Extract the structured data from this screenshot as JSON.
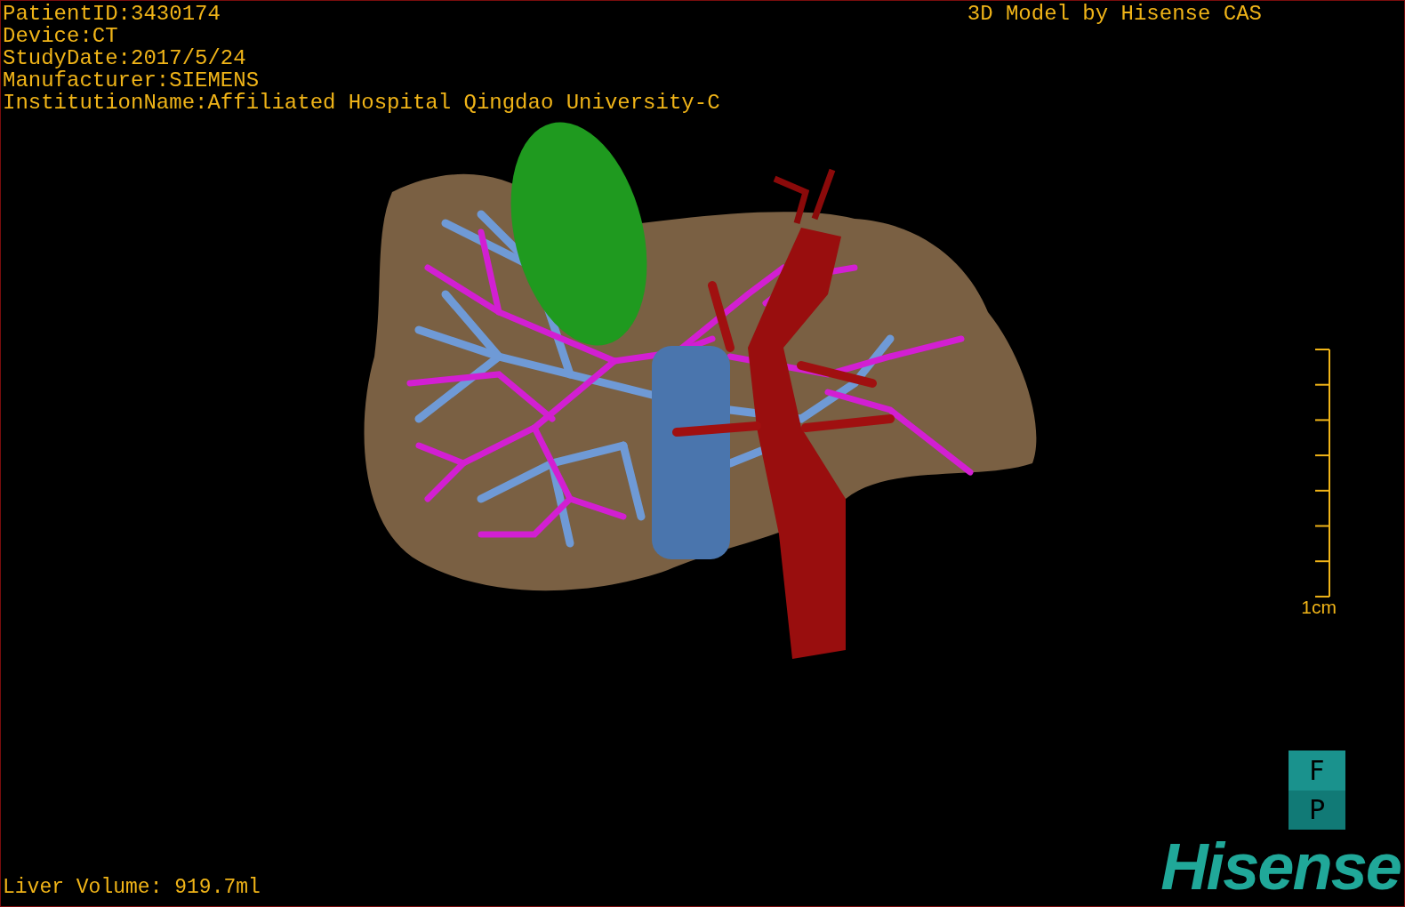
{
  "info_lines": [
    "PatientID:3430174",
    "Device:CT",
    "StudyDate:2017/5/24",
    "Manufacturer:SIEMENS",
    "InstitutionName:Affiliated Hospital Qingdao University-C"
  ],
  "title": "3D Model by Hisense CAS",
  "scale_bar": {
    "label": "1cm"
  },
  "liver_volume": "Liver Volume: 919.7ml",
  "orientation_cube": {
    "top_face": "F",
    "bottom_face": "P"
  },
  "logo": "Hisense"
}
